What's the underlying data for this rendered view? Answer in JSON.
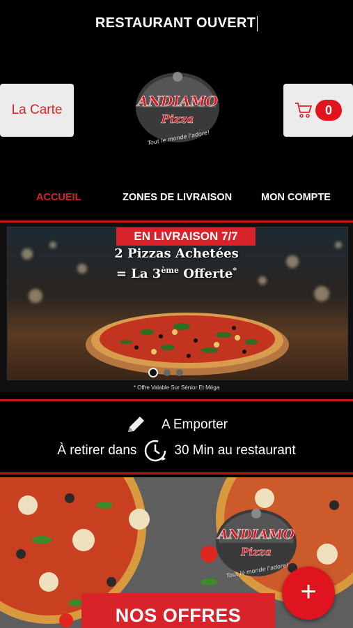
{
  "header": {
    "status": "RESTAURANT OUVERT"
  },
  "top_buttons": {
    "carte_label": "La Carte",
    "cart_count": "0"
  },
  "logo": {
    "brand": "ANDIAMO",
    "sub": "Pizza",
    "tagline": "Tout le monde l'adore!"
  },
  "nav": {
    "items": [
      {
        "label": "ACCUEIL",
        "active": true
      },
      {
        "label": "ZONES DE LIVRAISON"
      },
      {
        "label": "MON COMPTE"
      }
    ]
  },
  "banner": {
    "tag": "EN LIVRAISON 7/7",
    "promo_line1": "2 Pizzas Achetées",
    "promo_line2_a": "= La 3",
    "promo_line2_sup": "ème",
    "promo_line2_b": " Offerte",
    "promo_line2_star": "*",
    "footnote": "* Offre Valable Sur Sénior Et Méga",
    "slide_count": 3,
    "active_slide": 1
  },
  "emporter": {
    "title": "A Emporter",
    "line2_a": "À retirer dans",
    "line2_b": "30 Min au restaurant"
  },
  "offers": {
    "button_label": "NOS OFFRES",
    "fab_label": "+"
  },
  "colors": {
    "accent": "#d8232a",
    "background": "#000000",
    "button_bg": "#ececec"
  }
}
